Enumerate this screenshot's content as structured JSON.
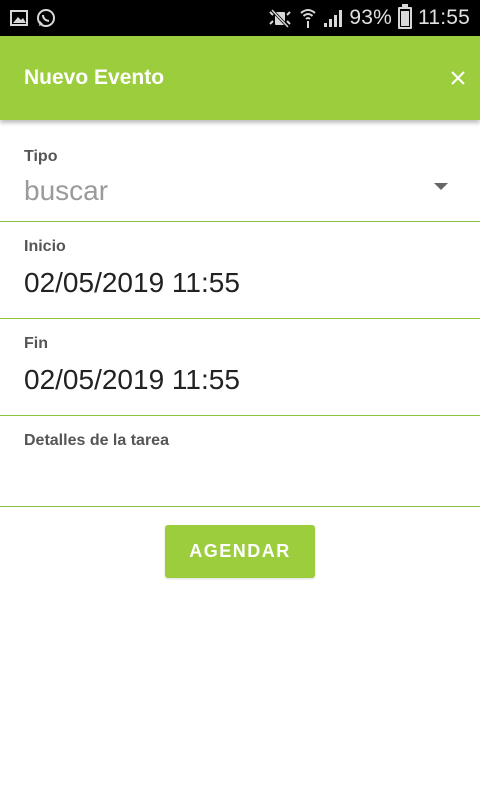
{
  "status_bar": {
    "battery_percent": "93%",
    "time": "11:55",
    "icons_left": [
      "image-icon",
      "whatsapp-icon"
    ],
    "icons_right": [
      "mute-icon",
      "wifi-icon",
      "signal-icon",
      "battery-icon"
    ]
  },
  "app_bar": {
    "title": "Nuevo Evento",
    "close_icon": "close-icon"
  },
  "form": {
    "tipo": {
      "label": "Tipo",
      "placeholder": "buscar"
    },
    "inicio": {
      "label": "Inicio",
      "value": "02/05/2019 11:55"
    },
    "fin": {
      "label": "Fin",
      "value": "02/05/2019 11:55"
    },
    "detalles": {
      "label": "Detalles de la tarea",
      "value": ""
    }
  },
  "actions": {
    "submit_label": "AGENDAR"
  },
  "colors": {
    "accent": "#9bcd3c",
    "divider": "#8cc63f",
    "status_bar": "#000000",
    "label": "#555555",
    "placeholder": "#9a9a9a"
  }
}
